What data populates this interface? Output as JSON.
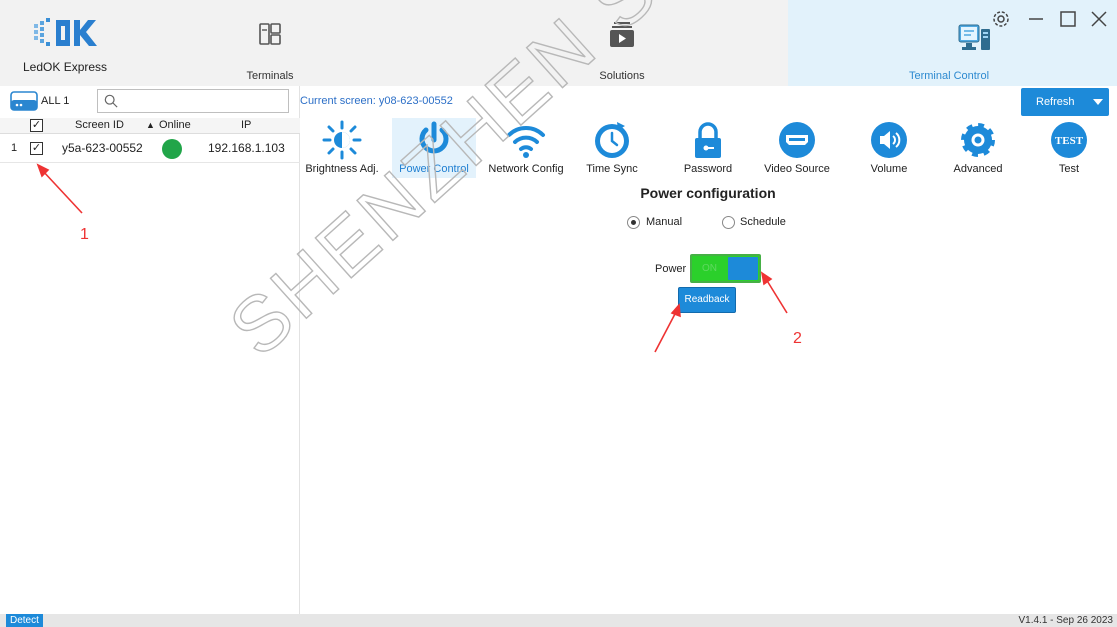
{
  "app": {
    "name": "LedOK Express",
    "logo_text": "OK"
  },
  "nav": {
    "tabs": [
      {
        "label": "Terminals",
        "icon": "terminals-icon"
      },
      {
        "label": "Solutions",
        "icon": "solutions-icon"
      },
      {
        "label": "Terminal Control",
        "icon": "terminal-control-icon",
        "active": true
      }
    ]
  },
  "window_controls": [
    "settings-icon",
    "minimize-icon",
    "maximize-icon",
    "close-icon"
  ],
  "terminal_panel": {
    "all_label": "ALL 1",
    "search_placeholder": "",
    "columns": [
      "✓",
      "Screen ID",
      "Online",
      "IP"
    ],
    "rows": [
      {
        "index": "1",
        "checked": "✓",
        "screen_id": "y5a-623-00552",
        "online": true,
        "ip": "192.168.1.103"
      }
    ]
  },
  "current_screen": "Current screen: y08-623-00552",
  "refresh_label": "Refresh",
  "toolbar": {
    "items": [
      {
        "label": "Brightness Adj.",
        "icon": "brightness-icon"
      },
      {
        "label": "Power Control",
        "icon": "power-icon",
        "active": true
      },
      {
        "label": "Network Config",
        "icon": "wifi-icon"
      },
      {
        "label": "Time Sync",
        "icon": "clock-icon"
      },
      {
        "label": "Password",
        "icon": "lock-icon"
      },
      {
        "label": "Video Source",
        "icon": "hdmi-icon"
      },
      {
        "label": "Volume",
        "icon": "speaker-icon"
      },
      {
        "label": "Advanced",
        "icon": "gear-icon"
      },
      {
        "label": "Test",
        "icon": "test-icon"
      }
    ]
  },
  "power_config": {
    "title": "Power configuration",
    "mode_manual": "Manual",
    "mode_schedule": "Schedule",
    "selected_mode": "Manual",
    "power_label": "Power",
    "power_state_text": "ON",
    "readback_label": "Readback"
  },
  "annotations": [
    "1",
    "2"
  ],
  "watermark_text": "SHENZHEN SYSOLUTION",
  "status": {
    "detect_label": "Detect",
    "version": "V1.4.1 - Sep 26 2023"
  },
  "colors": {
    "accent": "#1d8ad9",
    "online": "#21a549",
    "toggle_on": "#2bd02b",
    "annotation": "#e33333"
  }
}
